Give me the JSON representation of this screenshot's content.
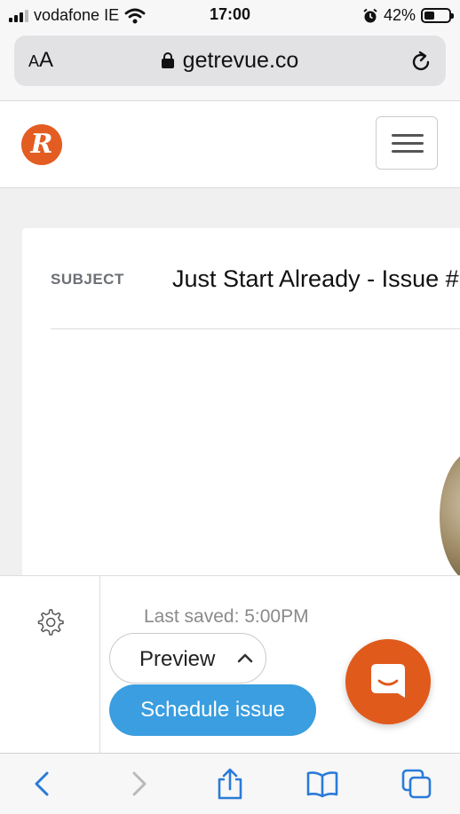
{
  "status_bar": {
    "carrier": "vodafone IE",
    "time": "17:00",
    "battery_percent": "42%",
    "battery_level": 0.42,
    "icons": [
      "signal-icon",
      "wifi-icon",
      "alarm-icon",
      "battery-icon"
    ]
  },
  "browser": {
    "text_size_small": "A",
    "text_size_large": "A",
    "url": "getrevue.co",
    "icons": [
      "lock-icon",
      "reload-icon",
      "back-icon",
      "forward-icon",
      "share-icon",
      "bookmarks-icon",
      "tabs-icon"
    ]
  },
  "header": {
    "logo_letter": "R",
    "logo_color": "#e35d22"
  },
  "editor": {
    "subject_label": "SUBJECT",
    "subject_value": "Just Start Already - Issue #",
    "last_saved": "Last saved: 5:00PM",
    "preview_label": "Preview",
    "schedule_label": "Schedule issue",
    "accent_color": "#3a9ee0",
    "chat_color": "#e05a1c"
  }
}
